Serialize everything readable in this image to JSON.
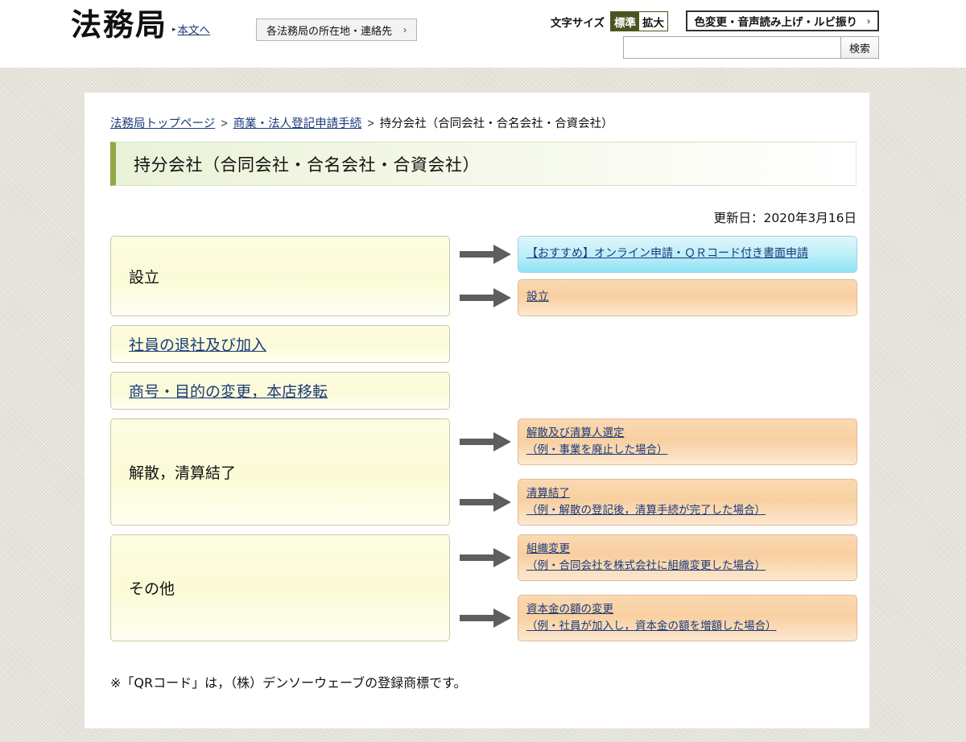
{
  "header": {
    "logo": "法務局",
    "skip_link": "本文へ",
    "office_button": "各法務局の所在地・連絡先",
    "office_button_chevron": "›",
    "textsize_label": "文字サイズ",
    "textsize_standard": "標準",
    "textsize_large": "拡大",
    "accessibility_button": "色変更・音声読み上げ・ルビ振り",
    "accessibility_chevron": "›",
    "search_value": "",
    "search_placeholder": "",
    "search_button": "検索",
    "active_textsize_color": "#4b5320"
  },
  "breadcrumb": {
    "home": "法務局トップページ",
    "sep1": ">",
    "parent": "商業・法人登記申請手続",
    "sep2": ">",
    "current": "持分会社（合同会社・合名会社・合資会社）"
  },
  "page": {
    "title": "持分会社（合同会社・合名会社・合資会社）",
    "update_date": "更新日：2020年3月16日",
    "footnote": "※「QRコード」は，（株）デンソーウェーブの登録商標です。",
    "accent_color": "#8faa43"
  },
  "flow": {
    "rows": [
      {
        "left_label": "設立",
        "left_is_link": false,
        "targets": [
          {
            "line1": "【おすすめ】オンライン申請・ＱＲコード付き書面申請",
            "line2": "",
            "color": "cyan"
          },
          {
            "line1": "設立",
            "line2": "",
            "color": "orange"
          }
        ]
      },
      {
        "left_label": "社員の退社及び加入",
        "left_is_link": true,
        "targets": []
      },
      {
        "left_label": "商号・目的の変更，本店移転",
        "left_is_link": true,
        "targets": []
      },
      {
        "left_label": "解散，清算結了",
        "left_is_link": false,
        "targets": [
          {
            "line1": "解散及び清算人選定",
            "line2": "（例・事業を廃止した場合）",
            "color": "orange"
          },
          {
            "line1": "清算結了",
            "line2": "（例・解散の登記後，清算手続が完了した場合）",
            "color": "orange"
          }
        ]
      },
      {
        "left_label": "その他",
        "left_is_link": false,
        "targets": [
          {
            "line1": "組織変更",
            "line2": "（例・合同会社を株式会社に組織変更した場合）",
            "color": "orange"
          },
          {
            "line1": "資本金の額の変更",
            "line2": "（例・社員が加入し，資本金の額を増額した場合）",
            "color": "orange"
          }
        ]
      }
    ]
  }
}
